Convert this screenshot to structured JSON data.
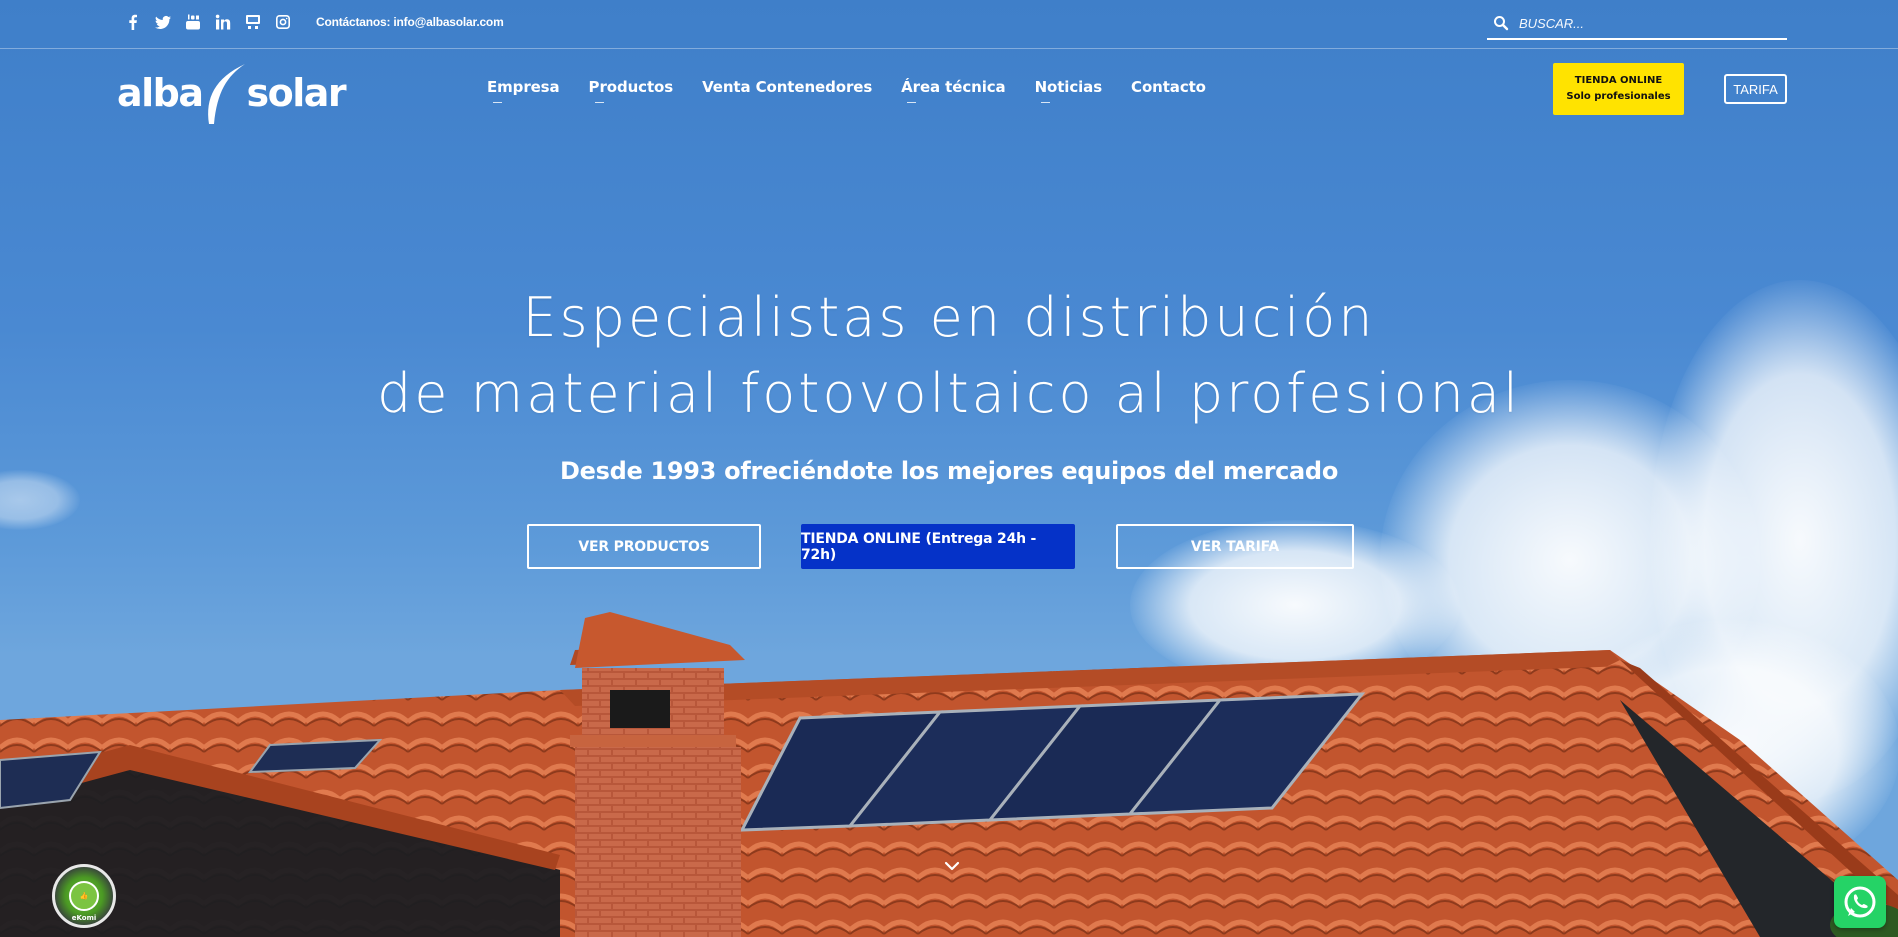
{
  "topbar": {
    "social_icons": [
      "facebook-icon",
      "twitter-icon",
      "youtube-icon",
      "linkedin-icon",
      "rss-icon",
      "instagram-icon"
    ],
    "contact_text": "Contáctanos: info@albasolar.com",
    "search_placeholder": "BUSCAR..."
  },
  "header": {
    "logo_left": "alba",
    "logo_right": "solar",
    "nav": [
      "Empresa",
      "Productos",
      "Venta Contenedores",
      "Área técnica",
      "Noticias",
      "Contacto"
    ],
    "store_button": {
      "line1": "TIENDA ONLINE",
      "line2": "Solo profesionales"
    },
    "tarifa_button": "TARIFA"
  },
  "hero": {
    "title_line1": "Especialistas en distribución",
    "title_line2": "de material fotovoltaico al profesional",
    "subtitle": "Desde 1993 ofreciéndote los mejores equipos del mercado",
    "cta_products": "VER PRODUCTOS",
    "cta_store": "TIENDA ONLINE (Entrega 24h - 72h)",
    "cta_tarifa": "VER TARIFA"
  },
  "widgets": {
    "badge_text": "eKomi"
  },
  "colors": {
    "sky": "#4a89d2",
    "store_yellow": "#ffe300",
    "cta_blue": "#0532c8",
    "whatsapp_green": "#25d366",
    "roof_tile": "#c75a32"
  }
}
